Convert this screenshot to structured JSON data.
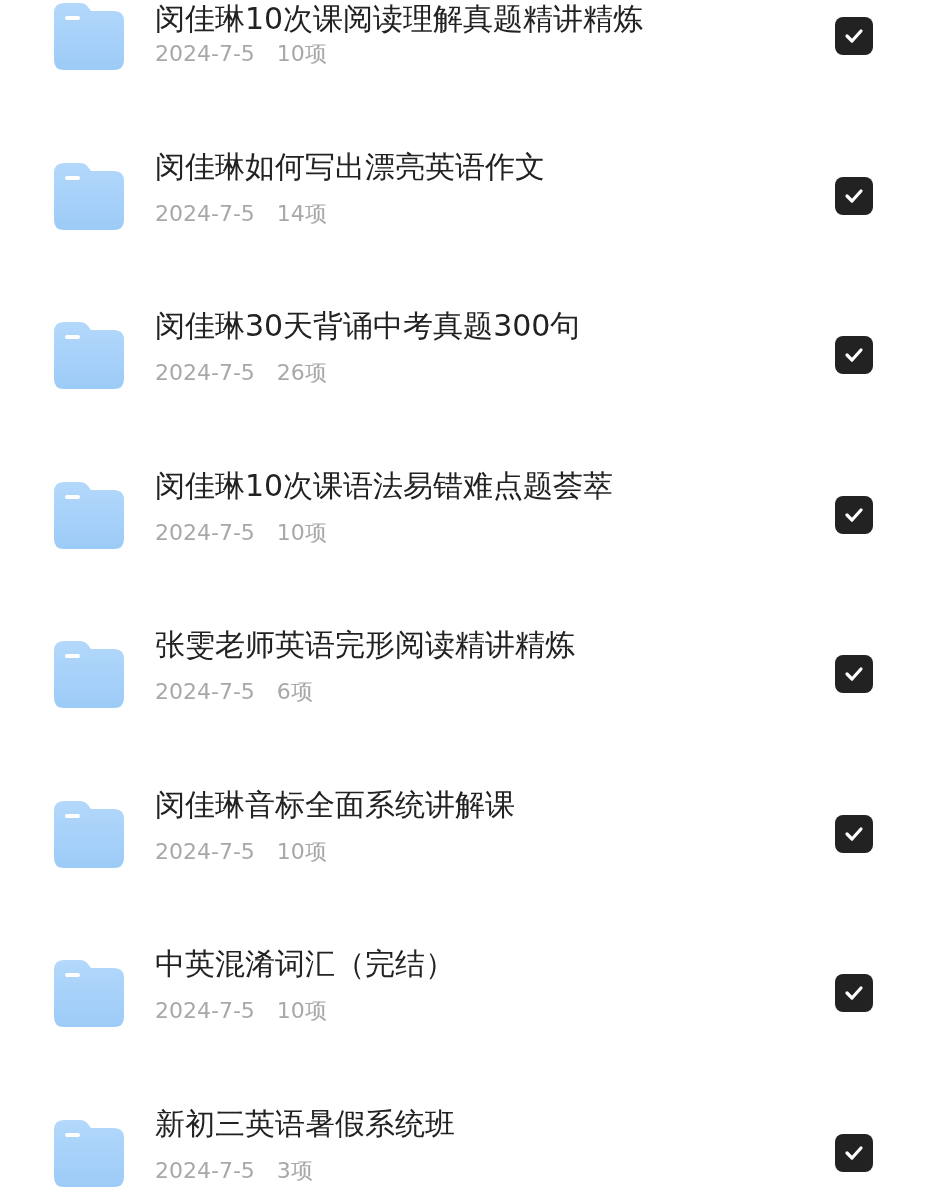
{
  "folders": [
    {
      "title": "闵佳琳10次课阅读理解真题精讲精炼",
      "date": "2024-7-5",
      "count": "10项",
      "checked": true
    },
    {
      "title": "闵佳琳如何写出漂亮英语作文",
      "date": "2024-7-5",
      "count": "14项",
      "checked": true
    },
    {
      "title": "闵佳琳30天背诵中考真题300句",
      "date": "2024-7-5",
      "count": "26项",
      "checked": true
    },
    {
      "title": "闵佳琳10次课语法易错难点题荟萃",
      "date": "2024-7-5",
      "count": "10项",
      "checked": true
    },
    {
      "title": "张雯老师英语完形阅读精讲精炼",
      "date": "2024-7-5",
      "count": "6项",
      "checked": true
    },
    {
      "title": "闵佳琳音标全面系统讲解课",
      "date": "2024-7-5",
      "count": "10项",
      "checked": true
    },
    {
      "title": "中英混淆词汇（完结）",
      "date": "2024-7-5",
      "count": "10项",
      "checked": true
    },
    {
      "title": "新初三英语暑假系统班",
      "date": "2024-7-5",
      "count": "3项",
      "checked": true
    }
  ]
}
